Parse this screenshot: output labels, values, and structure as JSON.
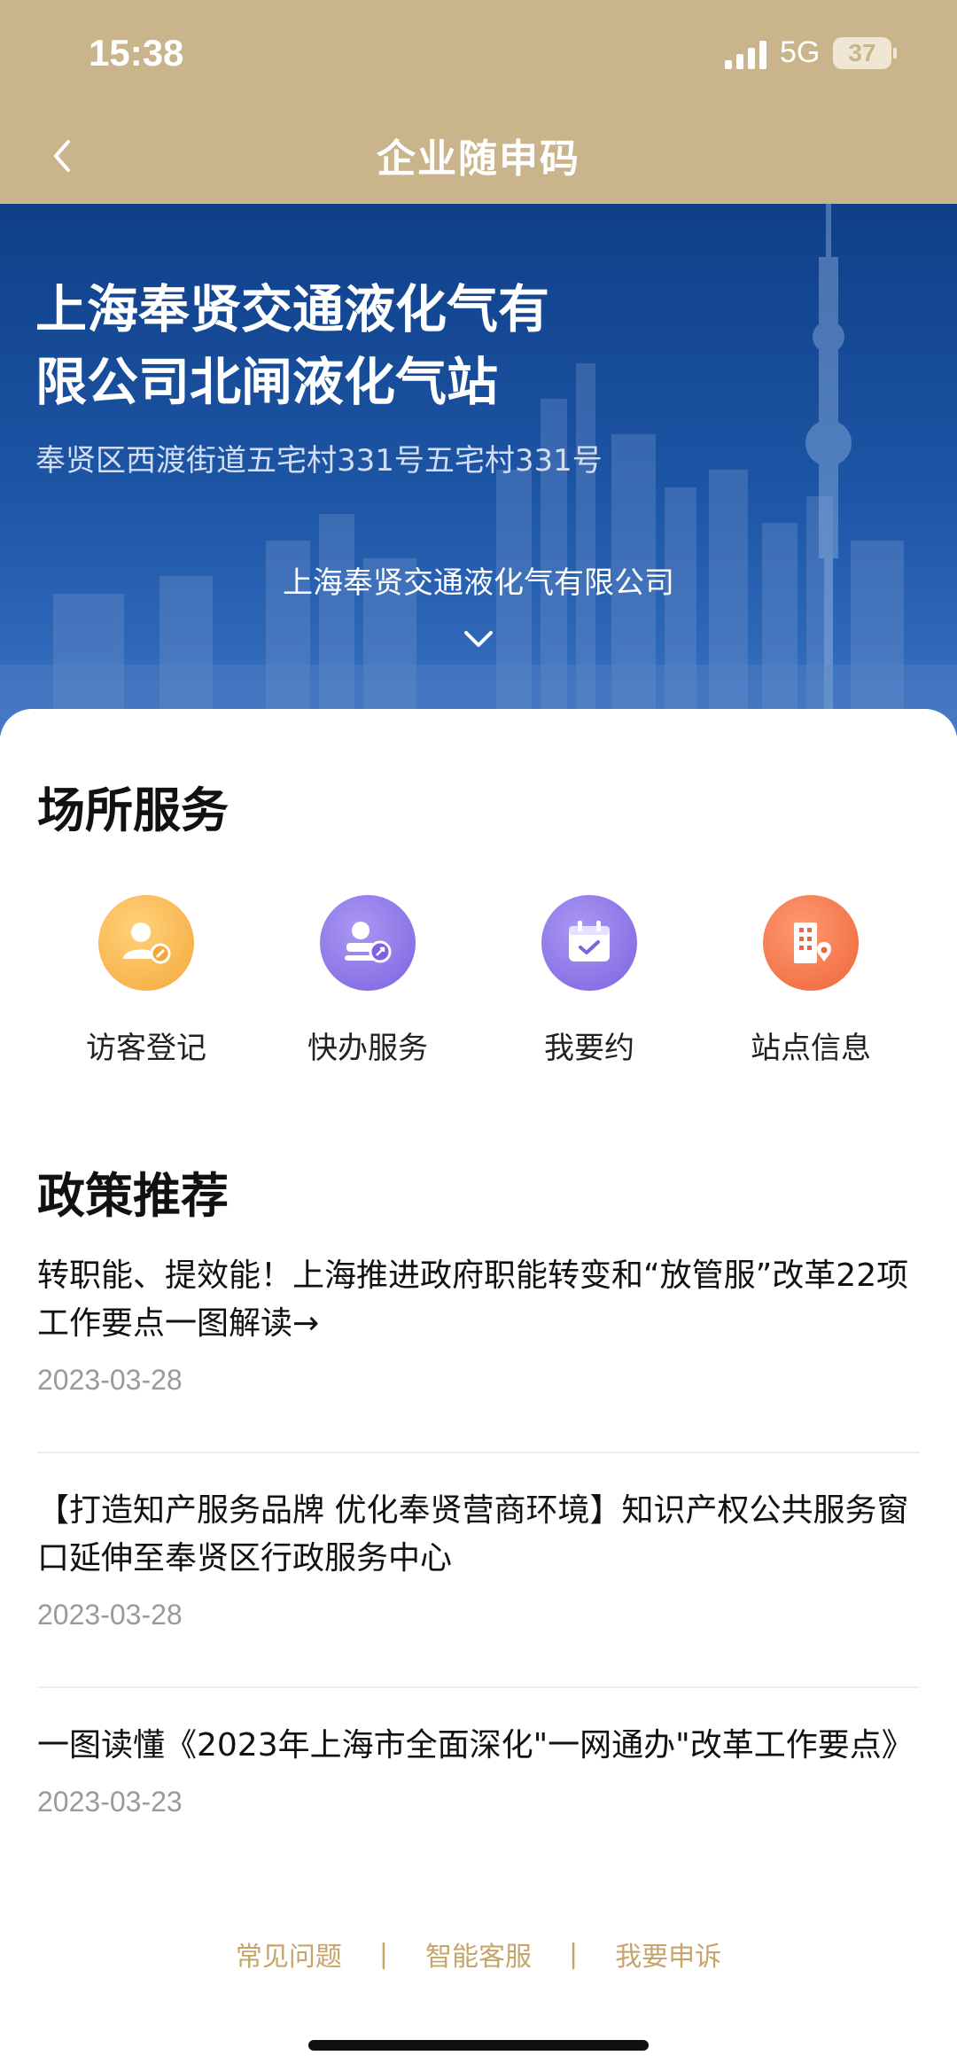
{
  "status_bar": {
    "time": "15:38",
    "network": "5G",
    "battery": "37"
  },
  "nav": {
    "title": "企业随申码"
  },
  "hero": {
    "title": "上海奉贤交通液化气有限公司北闸液化气站",
    "address": "奉贤区西渡街道五宅村331号五宅村331号",
    "company": "上海奉贤交通液化气有限公司"
  },
  "services": {
    "title": "场所服务",
    "items": [
      {
        "label": "访客登记",
        "icon": "visitor-icon",
        "color": "#f6b14a"
      },
      {
        "label": "快办服务",
        "icon": "quick-service-icon",
        "color": "#8a72e8"
      },
      {
        "label": "我要约",
        "icon": "calendar-icon",
        "color": "#8a72e8"
      },
      {
        "label": "站点信息",
        "icon": "building-icon",
        "color": "#f2734a"
      }
    ]
  },
  "policy": {
    "title": "政策推荐",
    "items": [
      {
        "title": "转职能、提效能！上海推进政府职能转变和“放管服”改革22项工作要点一图解读→",
        "date": "2023-03-28"
      },
      {
        "title": "【打造知产服务品牌 优化奉贤营商环境】知识产权公共服务窗口延伸至奉贤区行政服务中心",
        "date": "2023-03-28"
      },
      {
        "title": "一图读懂《2023年上海市全面深化\"一网通办\"改革工作要点》",
        "date": "2023-03-23"
      }
    ]
  },
  "footer": {
    "faq": "常见问题",
    "service": "智能客服",
    "complaint": "我要申诉"
  }
}
